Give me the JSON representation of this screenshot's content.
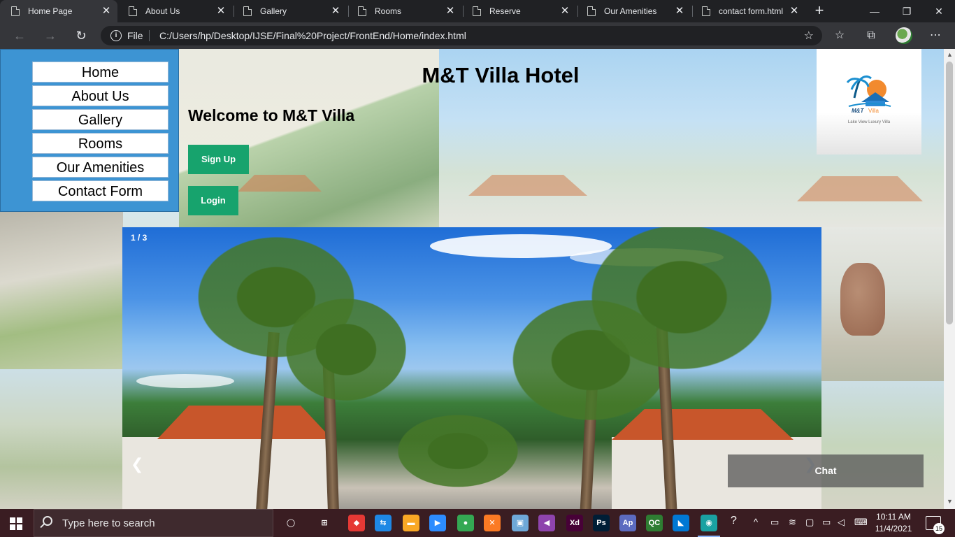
{
  "browser": {
    "tabs": [
      {
        "label": "Home Page",
        "active": true
      },
      {
        "label": "About Us",
        "active": false
      },
      {
        "label": "Gallery",
        "active": false
      },
      {
        "label": "Rooms",
        "active": false
      },
      {
        "label": "Reserve",
        "active": false
      },
      {
        "label": "Our Amenities",
        "active": false
      },
      {
        "label": "contact form.html",
        "active": false
      }
    ],
    "address_bar": {
      "scheme": "File",
      "url": "C:/Users/hp/Desktop/IJSE/Final%20Project/FrontEnd/Home/index.html"
    }
  },
  "page": {
    "nav": [
      "Home",
      "About Us",
      "Gallery",
      "Rooms",
      "Our Amenities",
      "Contact Form"
    ],
    "title": "M&T Villa Hotel",
    "welcome": "Welcome to M&T Villa",
    "signup_label": "Sign Up",
    "login_label": "Login",
    "logo": {
      "brand": "M&T Villa",
      "tagline": "Lake View Luxury Villa"
    },
    "slideshow": {
      "counter": "1 / 3",
      "prev": "❮",
      "next": "❯"
    },
    "chat_label": "Chat"
  },
  "taskbar": {
    "search_placeholder": "Type here to search",
    "time": "10:11 AM",
    "date": "11/4/2021",
    "notification_count": "15",
    "apps": [
      {
        "name": "task-view",
        "glyph": "◯",
        "color": "transparent"
      },
      {
        "name": "task-switcher",
        "glyph": "⊞",
        "color": "transparent"
      },
      {
        "name": "anydesk",
        "glyph": "◆",
        "color": "#e53935"
      },
      {
        "name": "teamviewer",
        "glyph": "⇆",
        "color": "#1e88e5"
      },
      {
        "name": "file-explorer",
        "glyph": "▬",
        "color": "#f9a825"
      },
      {
        "name": "zoom",
        "glyph": "▶",
        "color": "#2d8cff"
      },
      {
        "name": "chrome",
        "glyph": "●",
        "color": "#34a853"
      },
      {
        "name": "xampp",
        "glyph": "✕",
        "color": "#fb7a24"
      },
      {
        "name": "virtualbox",
        "glyph": "▣",
        "color": "#6ea8d8"
      },
      {
        "name": "visual-studio",
        "glyph": "◀",
        "color": "#8e44ad"
      },
      {
        "name": "adobe-xd",
        "glyph": "Xd",
        "color": "#470137"
      },
      {
        "name": "photoshop",
        "glyph": "Ps",
        "color": "#001e36"
      },
      {
        "name": "appium",
        "glyph": "Ap",
        "color": "#5c6bc0"
      },
      {
        "name": "qc",
        "glyph": "QC",
        "color": "#2e7d32"
      },
      {
        "name": "vscode",
        "glyph": "◣",
        "color": "#0078d4"
      },
      {
        "name": "edge",
        "glyph": "◉",
        "color": "#1aa2a2"
      }
    ]
  },
  "colors": {
    "nav_bg": "#3d94d3",
    "button_green": "#17a36d",
    "taskbar": "#3a1d22"
  }
}
